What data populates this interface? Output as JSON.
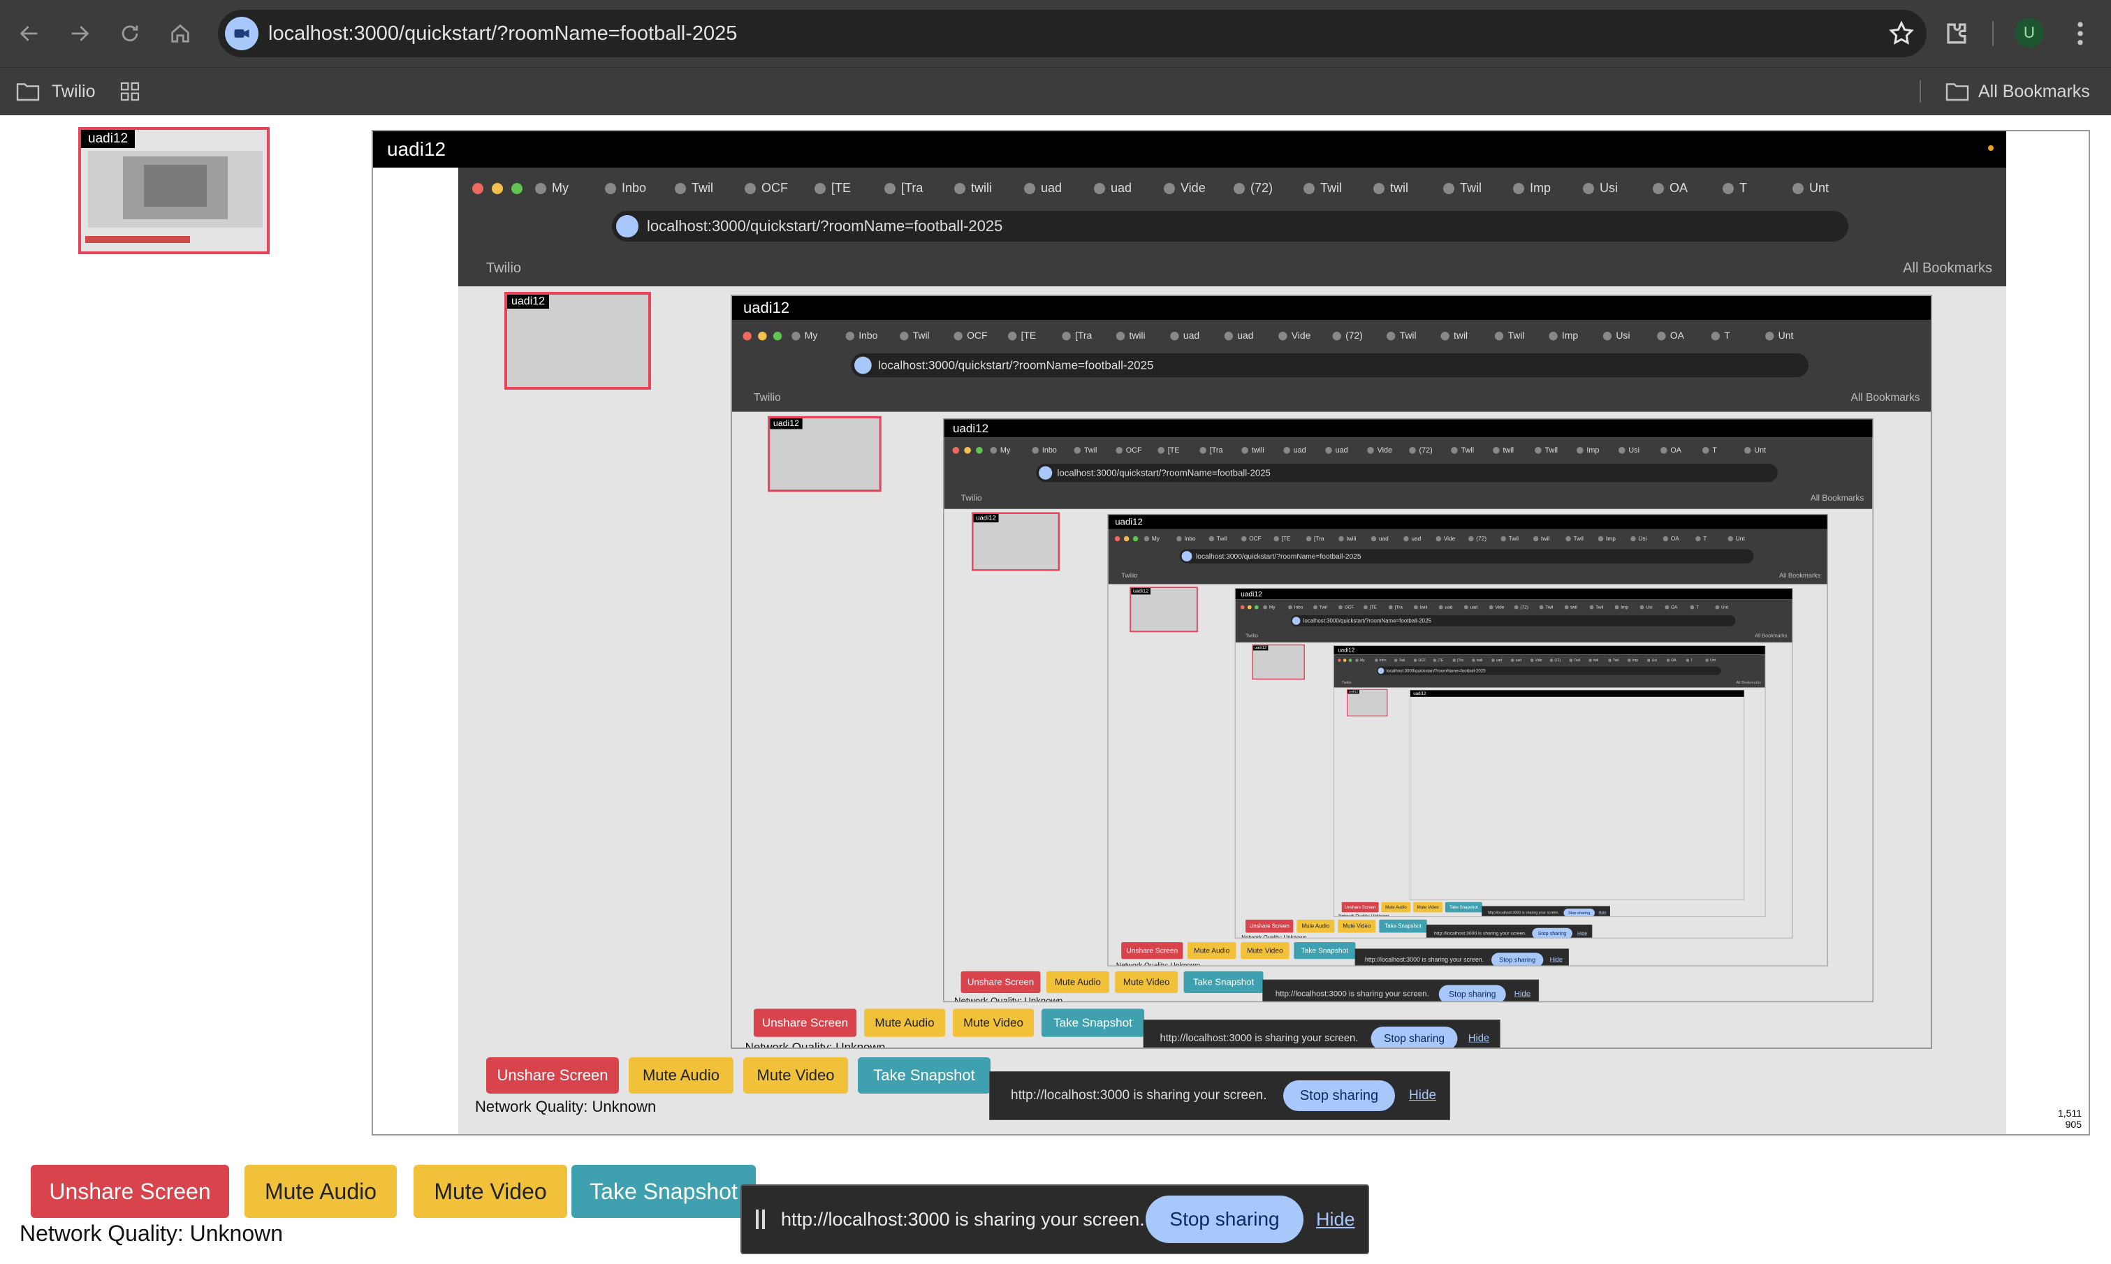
{
  "browser": {
    "url": "localhost:3000/quickstart/?roomName=football-2025",
    "profile_initial": "U",
    "bookmarks": {
      "folder": "Twilio",
      "all": "All Bookmarks"
    }
  },
  "participants": {
    "local_name": "uadi12",
    "remote_name": "uadi12",
    "remote_video_size": [
      "1,511",
      "905"
    ]
  },
  "controls": {
    "unshare": "Unshare Screen",
    "mute_audio": "Mute Audio",
    "mute_video": "Mute Video",
    "snapshot": "Take Snapshot",
    "network_quality": "Network Quality: Unknown"
  },
  "share_bar": {
    "message": "http://localhost:3000 is sharing your screen.",
    "stop": "Stop sharing",
    "hide": "Hide"
  },
  "nested_tabs": [
    "My",
    "Inbo",
    "Twil",
    "OCF",
    "[TE",
    "[Tra",
    "twili",
    "uad",
    "uad",
    "Vide",
    "(72)",
    "Twil",
    "twil",
    "Twil",
    "Imp",
    "Usi",
    "OA",
    "T",
    "Unt"
  ],
  "colors": {
    "unshare": "#d9434b",
    "mute": "#f2c13a",
    "snapshot": "#3fa1b0",
    "stop": "#a8c7fa",
    "local_border": "#e8435a"
  }
}
